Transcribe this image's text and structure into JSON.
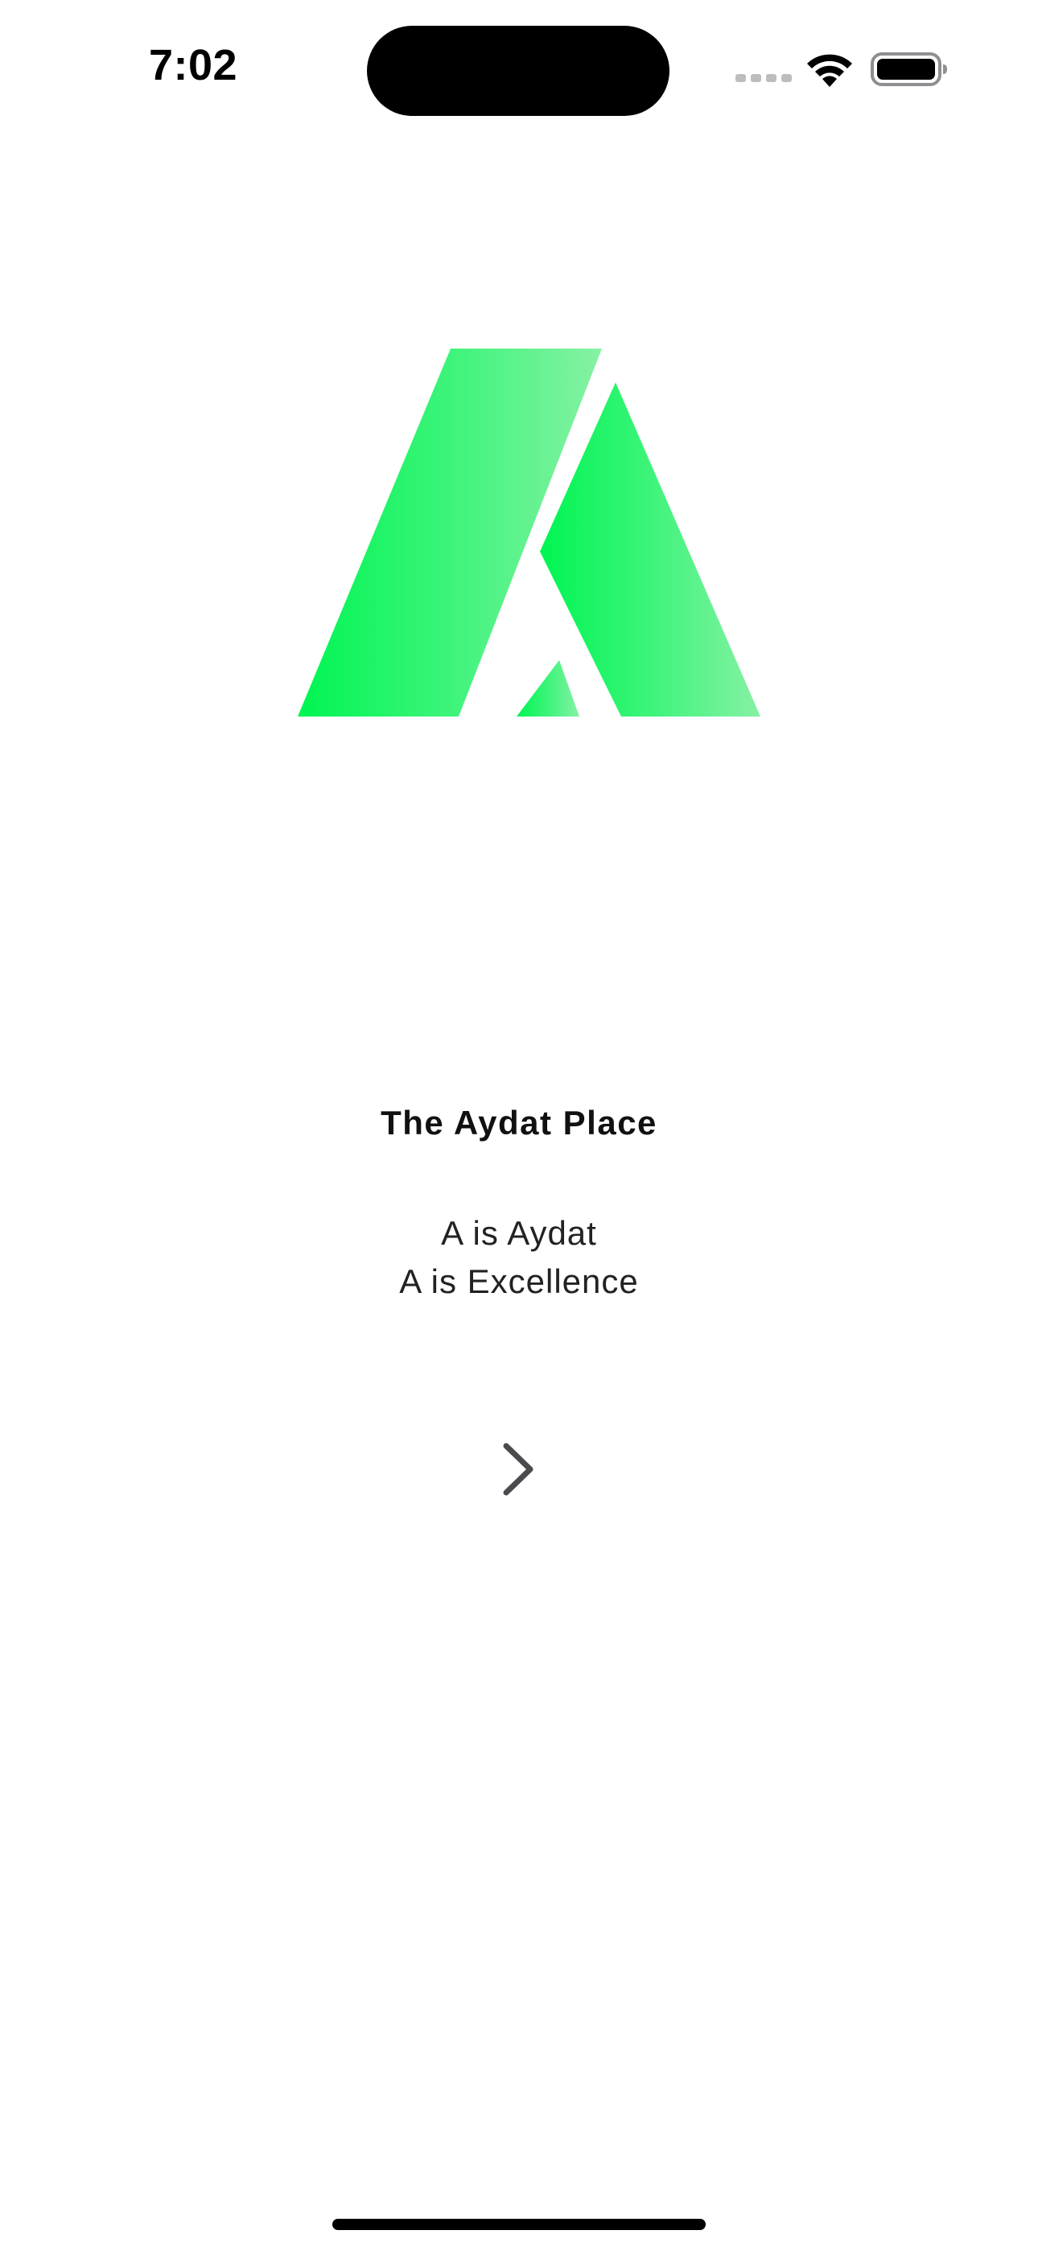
{
  "status_bar": {
    "time": "7:02",
    "signal_icon": "cellular-signal-icon",
    "wifi_icon": "wifi-icon",
    "battery_icon": "battery-full-icon"
  },
  "logo": {
    "icon": "aydat-logo-icon",
    "colors": {
      "primary": "#00F552",
      "secondary": "#7DF29E"
    }
  },
  "main": {
    "title": "The Aydat Place",
    "tagline_lines": [
      "A is Aydat",
      "A is Excellence"
    ],
    "next_icon": "chevron-right-icon"
  },
  "theme": {
    "background": "#FFFFFF",
    "text": "#111111",
    "chevron": "#4A4A4F"
  }
}
